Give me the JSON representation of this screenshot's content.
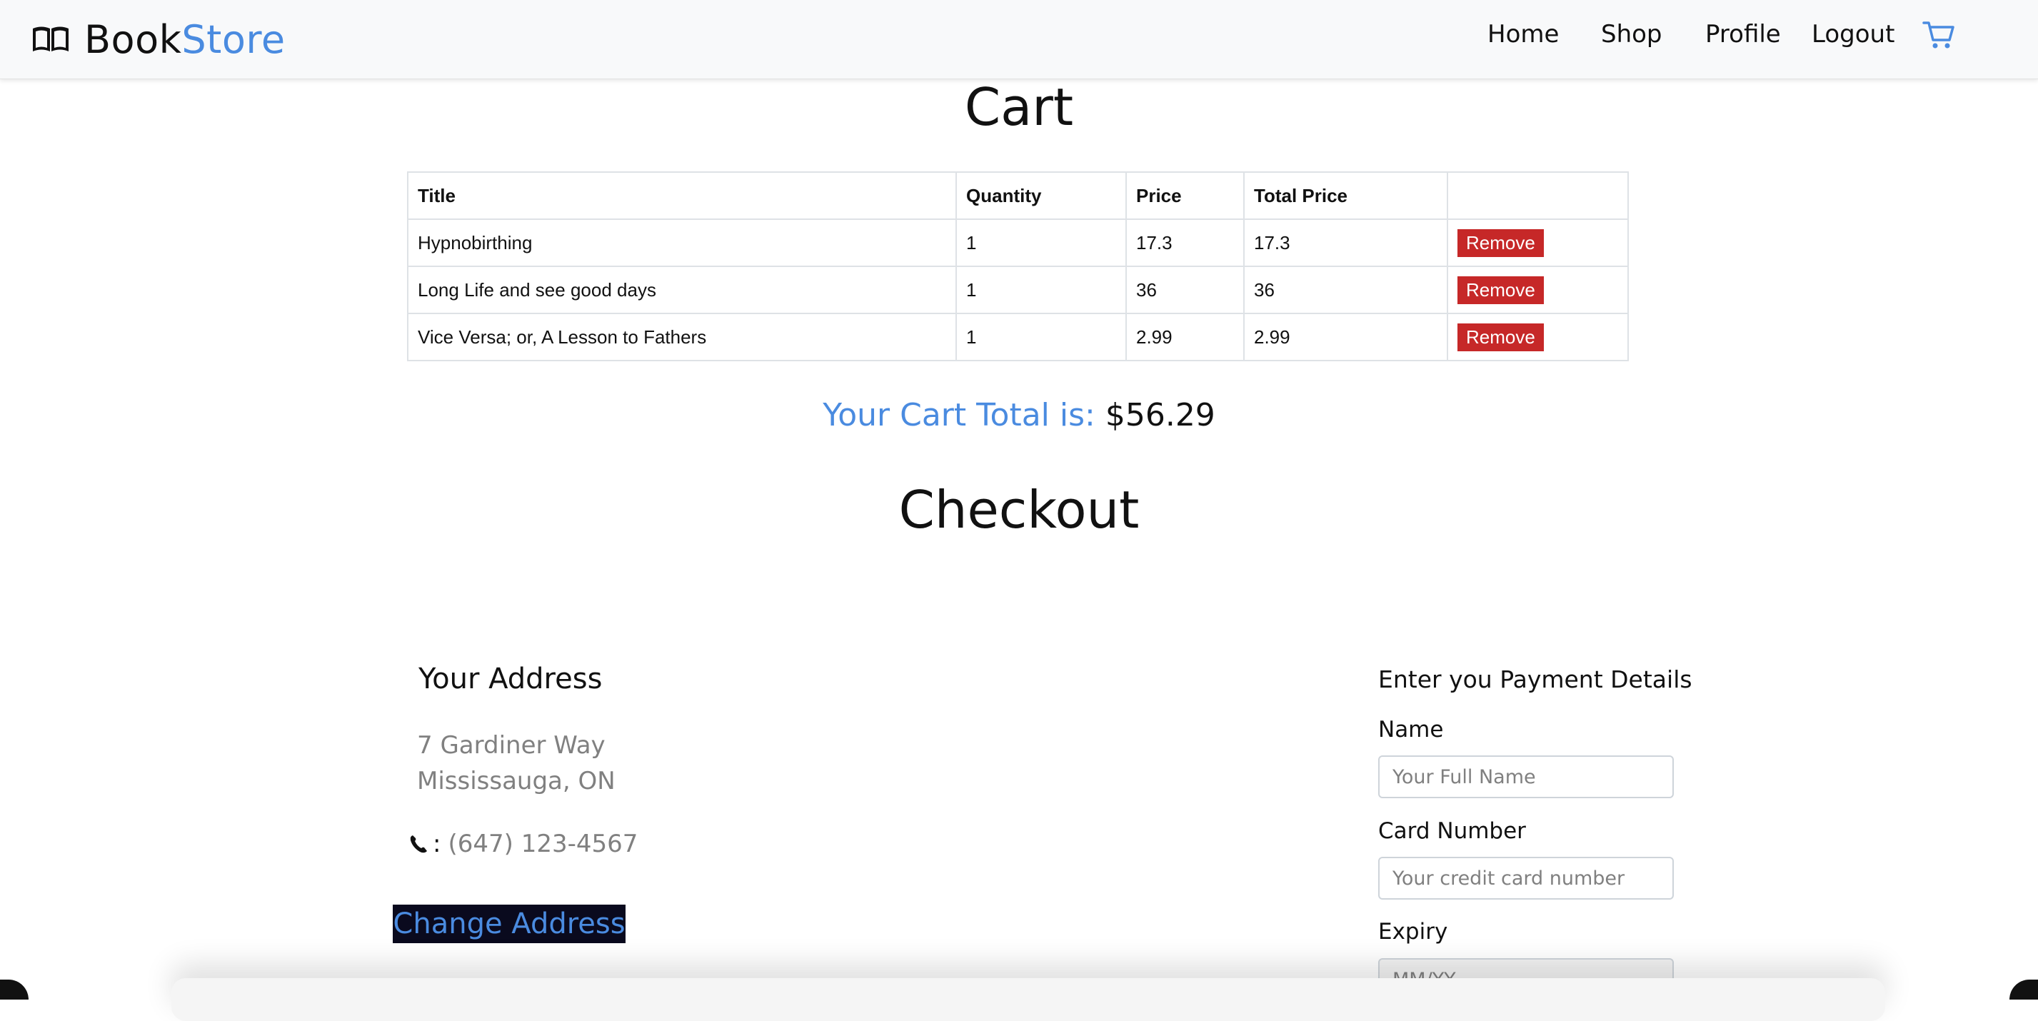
{
  "brand": {
    "name_part1": "Book",
    "name_part2": "Store"
  },
  "nav": {
    "home": "Home",
    "shop": "Shop",
    "profile": "Profile",
    "logout": "Logout"
  },
  "cart": {
    "title": "Cart",
    "columns": [
      "Title",
      "Quantity",
      "Price",
      "Total Price",
      ""
    ],
    "rows": [
      {
        "title": "Hypnobirthing",
        "quantity": "1",
        "price": "17.3",
        "total": "17.3",
        "action": "Remove"
      },
      {
        "title": "Long Life and see good days",
        "quantity": "1",
        "price": "36",
        "total": "36",
        "action": "Remove"
      },
      {
        "title": "Vice Versa; or, A Lesson to Fathers",
        "quantity": "1",
        "price": "2.99",
        "total": "2.99",
        "action": "Remove"
      }
    ],
    "total_label": "Your Cart Total is:",
    "total_value": "$56.29"
  },
  "checkout": {
    "title": "Checkout",
    "address": {
      "heading": "Your Address",
      "line1": "7 Gardiner Way",
      "line2": "Mississauga, ON",
      "phone_sep": ":",
      "phone": "(647) 123-4567",
      "change_button": "Change Address"
    },
    "payment": {
      "heading": "Enter you Payment Details",
      "name_label": "Name",
      "name_placeholder": "Your Full Name",
      "card_label": "Card Number",
      "card_placeholder": "Your credit card number",
      "expiry_label": "Expiry",
      "expiry_placeholder": "MM/YY"
    }
  },
  "colors": {
    "accent": "#4a8be0",
    "remove": "#c62828",
    "navbar_bg": "#f8f9fa"
  },
  "icons": {
    "brand": "open-book-icon",
    "cart": "shopping-cart-icon",
    "phone": "phone-icon"
  }
}
